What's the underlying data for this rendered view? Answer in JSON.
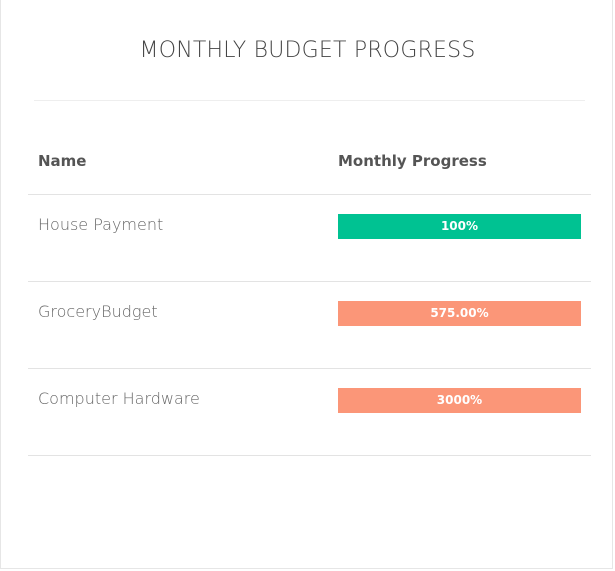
{
  "widget": {
    "title": "MONTHLY BUDGET PROGRESS"
  },
  "table": {
    "headers": {
      "name": "Name",
      "progress": "Monthly Progress"
    },
    "rows": [
      {
        "name": "House Payment",
        "progress_label": "100%",
        "progress_fraction": 1.0,
        "color": "#00c292"
      },
      {
        "name": "GroceryBudget",
        "progress_label": "575.00%",
        "progress_fraction": 1.0,
        "color": "#fb9678"
      },
      {
        "name": "Computer Hardware",
        "progress_label": "3000%",
        "progress_fraction": 1.0,
        "color": "#fb9678"
      }
    ]
  },
  "colors": {
    "success": "#00c292",
    "over_budget": "#fb9678"
  }
}
